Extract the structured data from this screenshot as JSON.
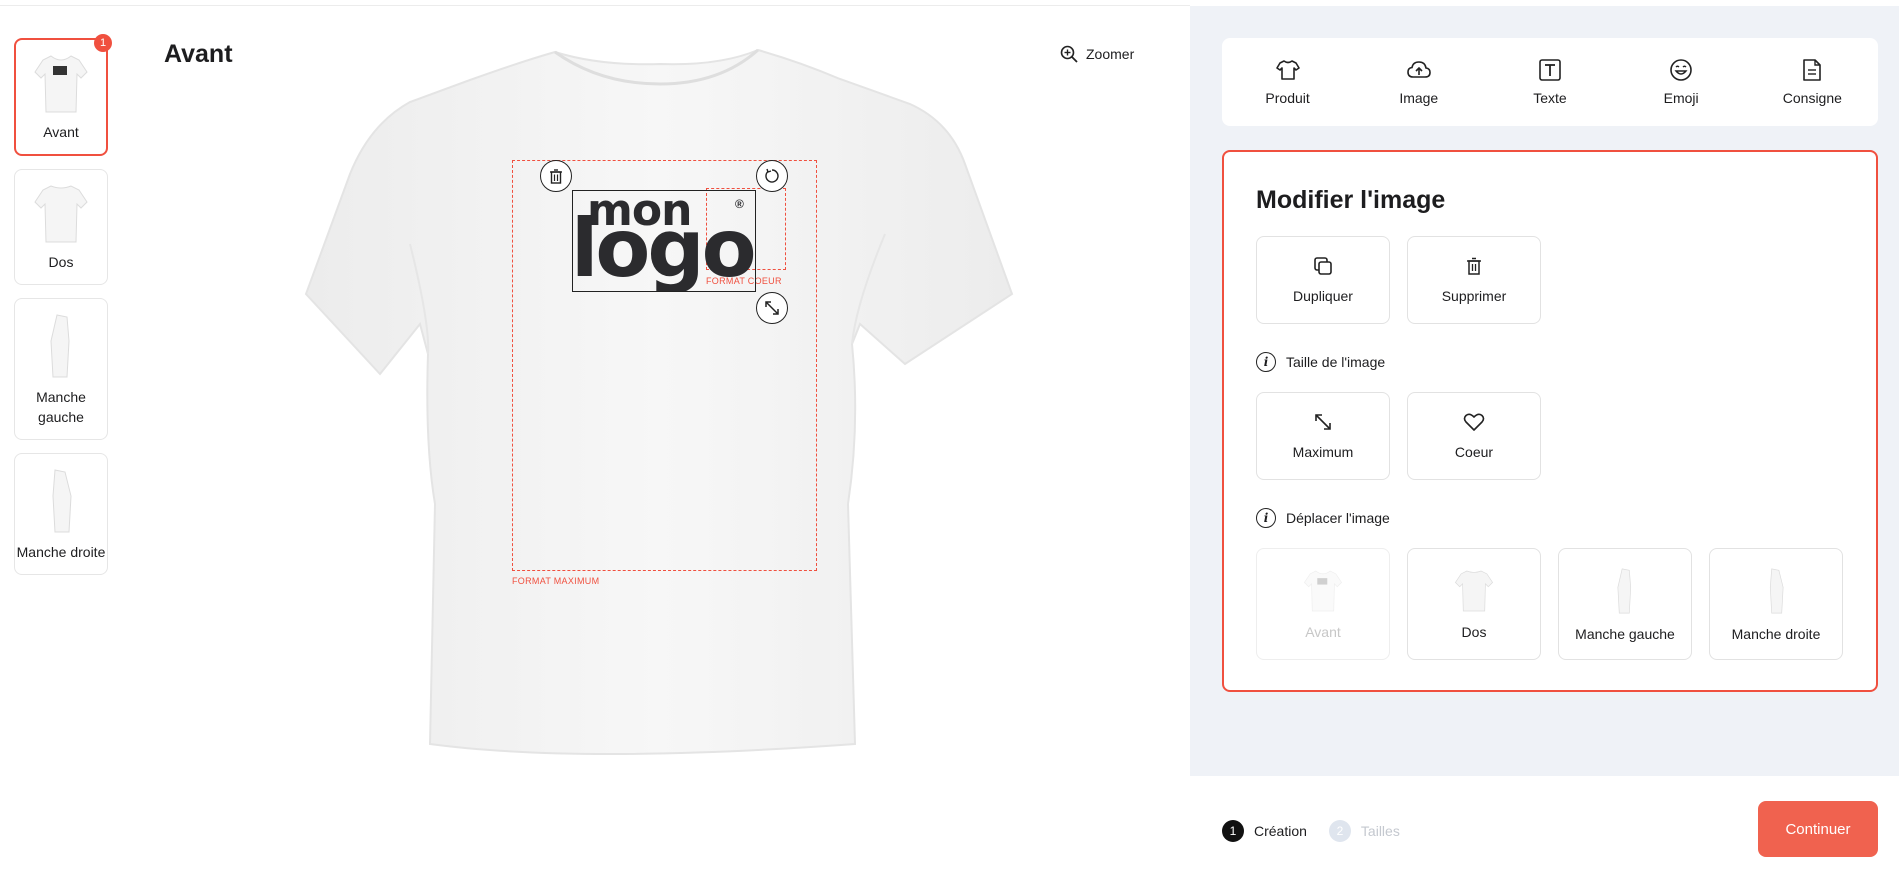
{
  "views": [
    {
      "label": "Avant",
      "badge": "1",
      "active": true
    },
    {
      "label": "Dos",
      "active": false
    },
    {
      "label": "Manche gauche",
      "active": false
    },
    {
      "label": "Manche droite",
      "active": false
    }
  ],
  "canvas": {
    "title": "Avant",
    "zoom_label": "Zoomer",
    "zone_max_label": "FORMAT MAXIMUM",
    "zone_heart_label": "FORMAT COEUR",
    "logo": {
      "line1": "mon",
      "line2": "logo",
      "reg": "®"
    }
  },
  "toolbar": {
    "items": [
      {
        "label": "Produit",
        "icon": "shirt-icon"
      },
      {
        "label": "Image",
        "icon": "cloud-upload-icon"
      },
      {
        "label": "Texte",
        "icon": "text-icon"
      },
      {
        "label": "Emoji",
        "icon": "emoji-icon"
      },
      {
        "label": "Consigne",
        "icon": "document-icon"
      }
    ]
  },
  "editor": {
    "title": "Modifier l'image",
    "duplicate": "Dupliquer",
    "delete": "Supprimer",
    "size_section": "Taille de l'image",
    "size_max": "Maximum",
    "size_heart": "Coeur",
    "move_section": "Déplacer l'image",
    "move_targets": [
      {
        "label": "Avant",
        "disabled": true
      },
      {
        "label": "Dos",
        "disabled": false
      },
      {
        "label": "Manche gauche",
        "disabled": false
      },
      {
        "label": "Manche droite",
        "disabled": false
      }
    ]
  },
  "footer": {
    "step1_num": "1",
    "step1_label": "Création",
    "step2_num": "2",
    "step2_label": "Tailles",
    "continue": "Continuer"
  },
  "colors": {
    "accent": "#f0503f",
    "panel_bg": "#eff2f7"
  }
}
